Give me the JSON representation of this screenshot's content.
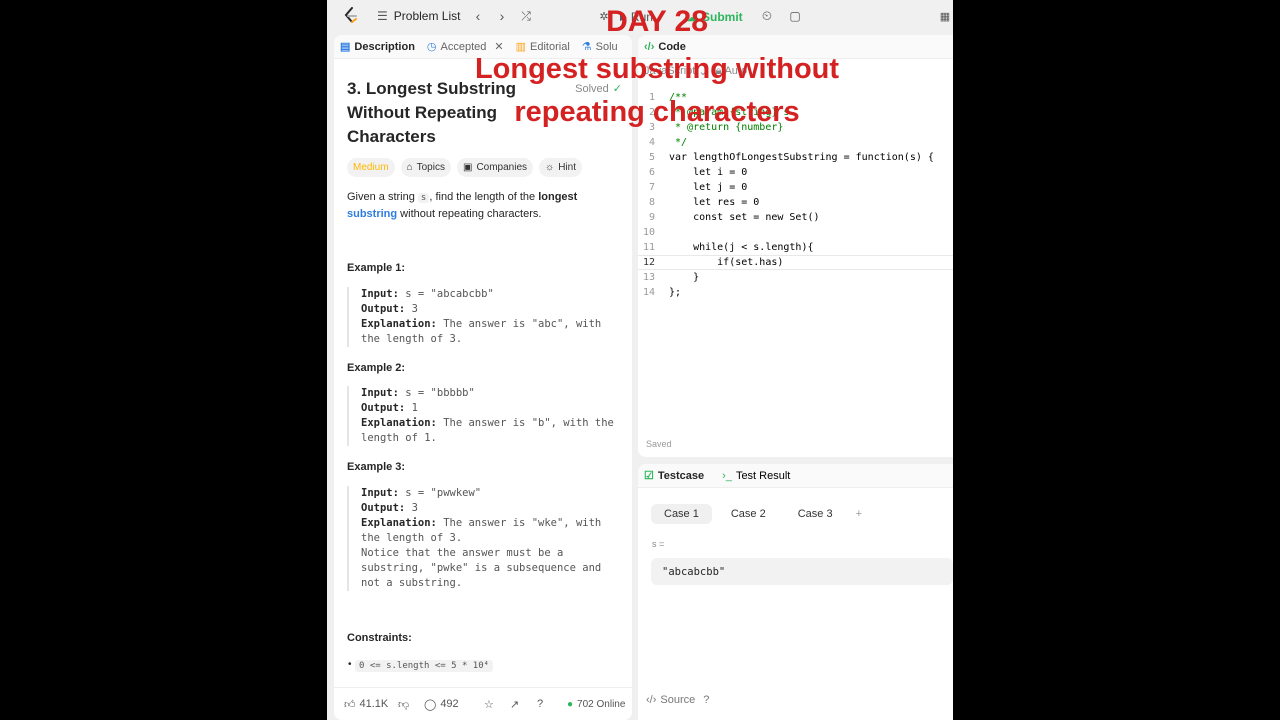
{
  "header": {
    "problem_list": "Problem List",
    "run": "Run",
    "submit": "Submit"
  },
  "left": {
    "tabs": [
      "Description",
      "Accepted",
      "Editorial",
      "Solu"
    ],
    "title": "3. Longest Substring Without Repeating Characters",
    "solved": "Solved",
    "chips": [
      "Medium",
      "Topics",
      "Companies",
      "Hint"
    ],
    "desc_1": "Given a string ",
    "desc_code": "s",
    "desc_2": ", find the length of the ",
    "desc_bold": "longest",
    "desc_link": "substring",
    "desc_3": " without repeating characters.",
    "examples": [
      {
        "title": "Example 1:",
        "input": "s = \"abcabcbb\"",
        "output": "3",
        "explanation": "The answer is \"abc\", with the length of 3."
      },
      {
        "title": "Example 2:",
        "input": "s = \"bbbbb\"",
        "output": "1",
        "explanation": "The answer is \"b\", with the length of 1."
      },
      {
        "title": "Example 3:",
        "input": "s = \"pwwkew\"",
        "output": "3",
        "explanation": "The answer is \"wke\", with the length of 3.\nNotice that the answer must be a substring, \"pwke\" is a subsequence and not a substring."
      }
    ],
    "labels": {
      "input": "Input:",
      "output": "Output:",
      "explanation": "Explanation:"
    },
    "constraints_title": "Constraints:",
    "constraint_1": "0 <= s.length <= 5 * 10⁴",
    "footer": {
      "likes": "41.1K",
      "comments": "492",
      "online": "702 Online"
    }
  },
  "code": {
    "tab": "Code",
    "lang": "JavaScript",
    "auto": "Auto",
    "lines": [
      "/**",
      " * @param {string} s",
      " * @return {number}",
      " */",
      "var lengthOfLongestSubstring = function(s) {",
      "    let i = 0",
      "    let j = 0",
      "    let res = 0",
      "    const set = new Set()",
      "",
      "    while(j < s.length){",
      "        if(set.has)",
      "    }",
      "};"
    ],
    "saved": "Saved"
  },
  "testcase": {
    "tab": "Testcase",
    "result_tab": "Test Result",
    "cases": [
      "Case 1",
      "Case 2",
      "Case 3"
    ],
    "add": "+",
    "s_label": "s =",
    "s_value": "\"abcabcbb\"",
    "source": "Source"
  },
  "overlay": {
    "day": "DAY 28",
    "line1": "Longest substring without",
    "line2": "repeating characters"
  }
}
